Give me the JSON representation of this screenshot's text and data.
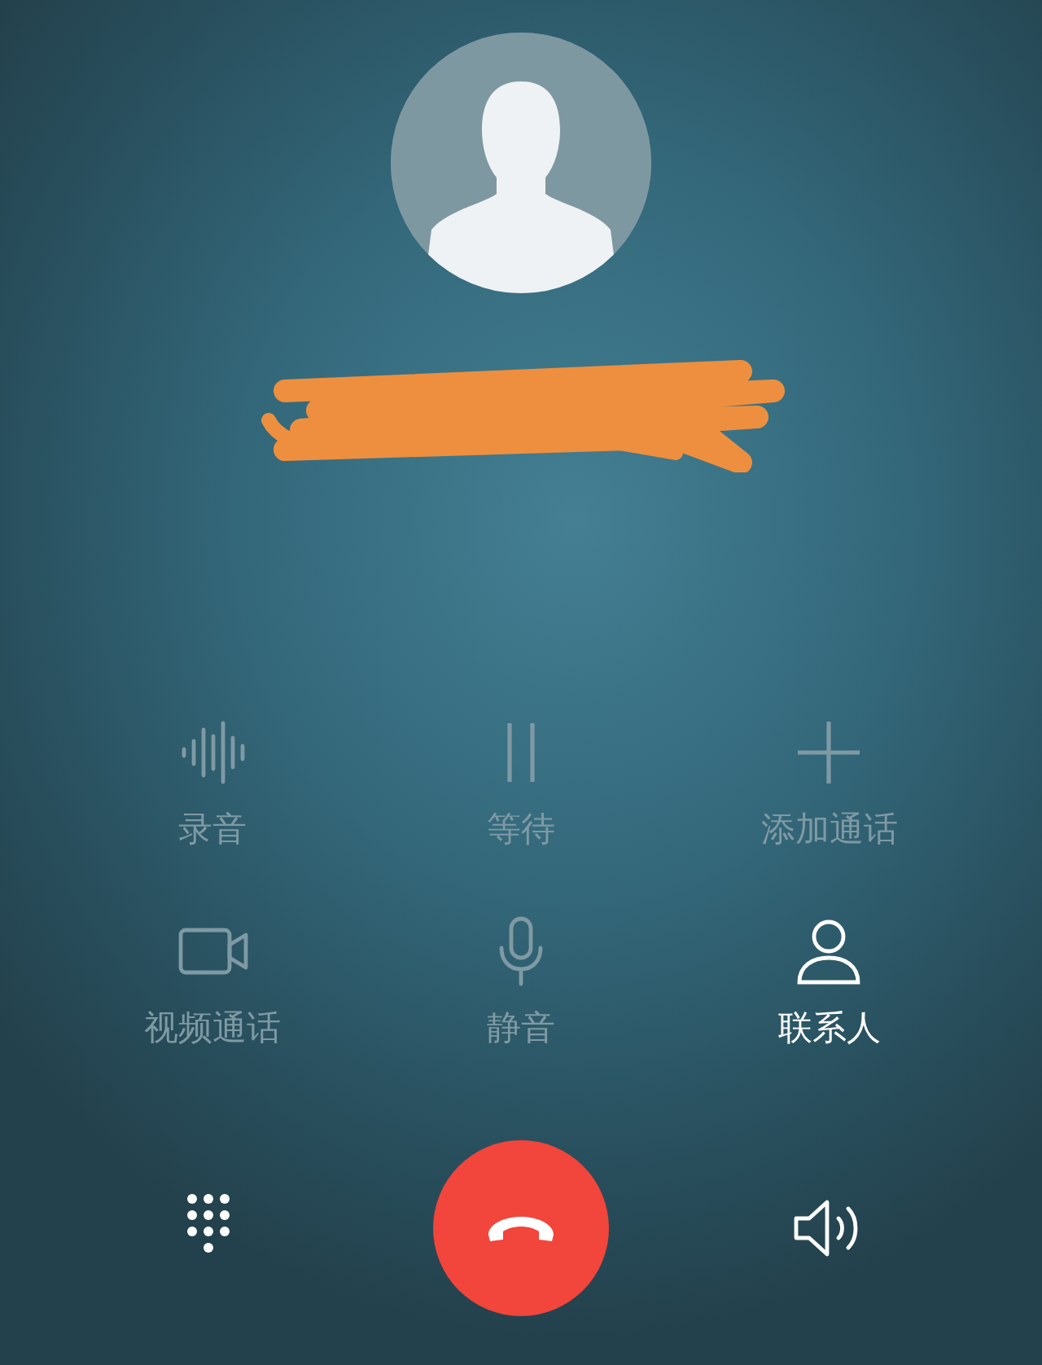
{
  "caller": {
    "redacted": true
  },
  "actions": [
    {
      "kind": "waveform",
      "label": "录音",
      "disabled": true
    },
    {
      "kind": "pause",
      "label": "等待",
      "disabled": true
    },
    {
      "kind": "plus",
      "label": "添加通话",
      "disabled": true
    },
    {
      "kind": "video",
      "label": "视频通话",
      "disabled": true
    },
    {
      "kind": "mic",
      "label": "静音",
      "disabled": true
    },
    {
      "kind": "person",
      "label": "联系人",
      "disabled": false
    }
  ],
  "bottom": [
    {
      "kind": "dialpad"
    },
    {
      "kind": "hangup"
    },
    {
      "kind": "speaker"
    }
  ]
}
